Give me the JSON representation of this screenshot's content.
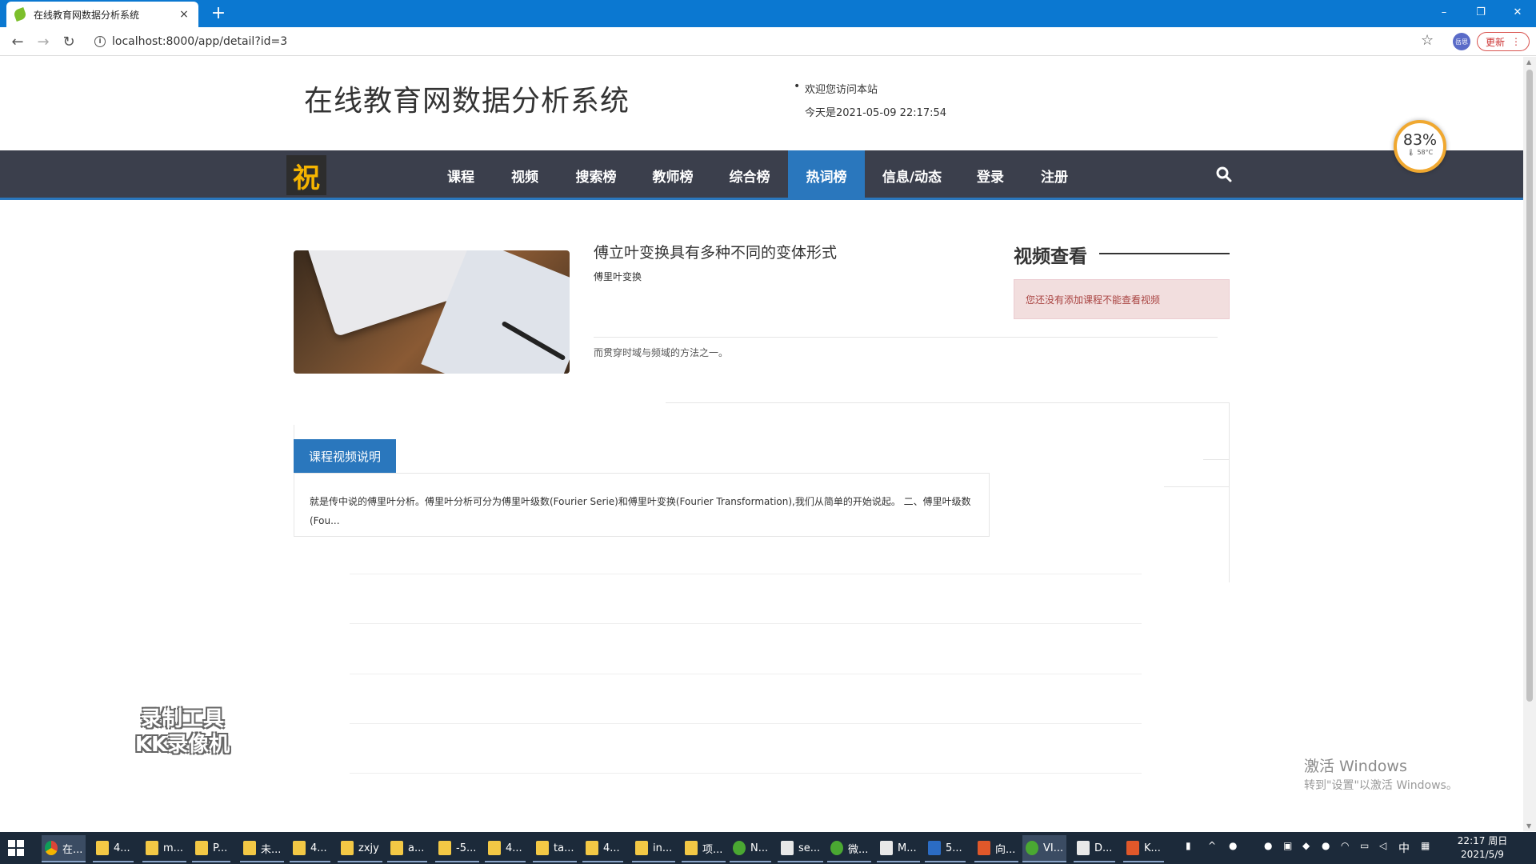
{
  "browser": {
    "tab_title": "在线教育网数据分析系统",
    "tab_close": "×",
    "new_tab": "+",
    "url": "localhost:8000/app/detail?id=3",
    "profile_label": "岳思",
    "update_label": "更新",
    "window_controls": {
      "minimize": "–",
      "restore": "❐",
      "close": "✕"
    }
  },
  "header": {
    "site_title": "在线教育网数据分析系统",
    "welcome": "欢迎您访问本站",
    "today": "今天是2021-05-09 22:17:54"
  },
  "nav": {
    "logo_glyph": "祝",
    "items": [
      "课程",
      "视频",
      "搜索榜",
      "教师榜",
      "综合榜",
      "热词榜",
      "信息/动态",
      "登录",
      "注册"
    ],
    "active_index": 5
  },
  "temp_gauge": {
    "percent": "83%",
    "temp": "🌡 58°C"
  },
  "course": {
    "title": "傅立叶变换具有多种不同的变体形式",
    "subtitle": "傅里叶变换",
    "desc": "而贯穿时域与频域的方法之一。"
  },
  "sidebar": {
    "title": "视频查看",
    "alert": "您还没有添加课程不能查看视频"
  },
  "panel": {
    "tab_label": "课程视频说明",
    "text": "就是传中说的傅里叶分析。傅里叶分析可分为傅里叶级数(Fourier Serie)和傅里叶变换(Fourier Transformation),我们从简单的开始说起。 二、傅里叶级数(Fou..."
  },
  "overlay": {
    "watermark_line1": "录制工具",
    "watermark_line2": "KK录像机",
    "activate_title": "激活 Windows",
    "activate_sub": "转到\"设置\"以激活 Windows。"
  },
  "taskbar": {
    "items": [
      "在...",
      "4...",
      "m...",
      "P...",
      "未...",
      "4...",
      "zxjy",
      "a...",
      "-5...",
      "4...",
      "ta...",
      "4...",
      "in...",
      "项...",
      "N...",
      "se...",
      "微...",
      "M...",
      "5...",
      "向...",
      "VI...",
      "D...",
      "K..."
    ],
    "ime": "中",
    "clock_time": "22:17 周日",
    "clock_date": "2021/5/9"
  }
}
